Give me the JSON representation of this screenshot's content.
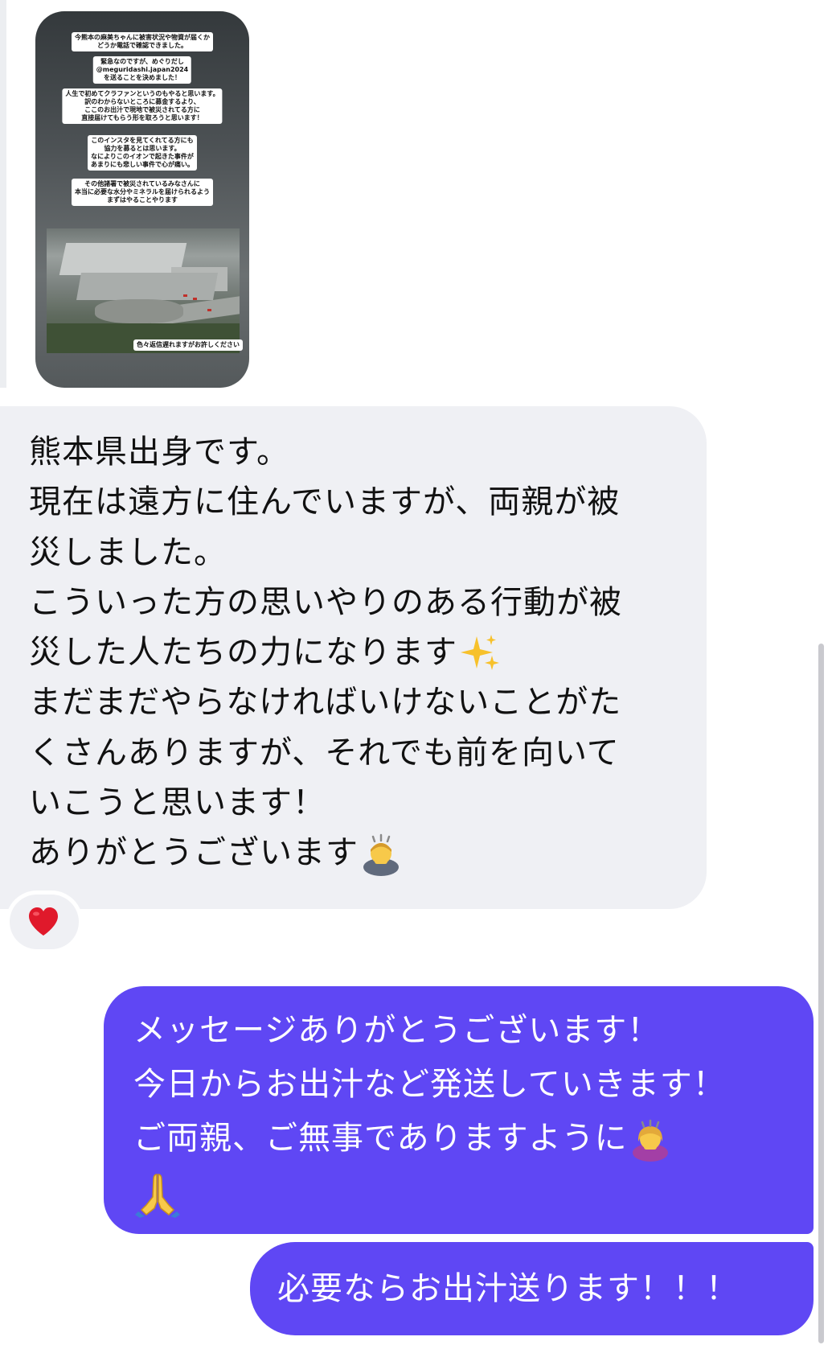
{
  "story": {
    "captions": [
      "今熊本の麻美ちゃんに被害状況や物資が届くか\nどうか電話で確認できました。",
      "緊急なのですが、めぐりだし\n@meguridashi.japan2024\nを送ることを決めました！",
      "人生で初めてクラファンというのもやると思います。\n訳のわからないところに募金するより、\nここのお出汁で現地で被災されてる方に\n直接届けてもらう形を取ろうと思います！",
      "このインスタを見てくれてる方にも\n協力を募るとは思います。\nなによりこのイオンで起きた事件が\nあまりにも悲しい事件で心が痛い。",
      "その他諸署で被災されているみなさんに\n本当に必要な水分やミネラルを届けられるよう\nまずはやることやります",
      "色々返信遅れますがお許しください"
    ]
  },
  "incoming_message": {
    "lines": [
      "熊本県出身です。",
      "現在は遠方に住んでいますが、両親が被",
      "災しました。",
      "こういった方の思いやりのある行動が被",
      "災した人たちの力になります",
      "まだまだやらなければいけないことがた",
      "くさんありますが、それでも前を向いて",
      "いこうと思います！",
      "ありがとうございます"
    ],
    "emoji_sparkles": "sparkles-emoji",
    "emoji_bow": "person-bowing-emoji"
  },
  "reaction": {
    "icon": "heart-icon",
    "color": "#e0192b"
  },
  "outgoing_messages": {
    "first": {
      "lines": [
        "メッセージありがとうございます！",
        "今日からお出汁など発送していきます！",
        "ご両親、ご無事でありますように"
      ],
      "emoji_bow": "woman-bowing-emoji",
      "emoji_pray": "folded-hands-emoji"
    },
    "second": {
      "text": "必要ならお出汁送ります！！！"
    }
  },
  "colors": {
    "incoming_bubble": "#eff0f4",
    "outgoing_bubble": "#5f47f4"
  }
}
